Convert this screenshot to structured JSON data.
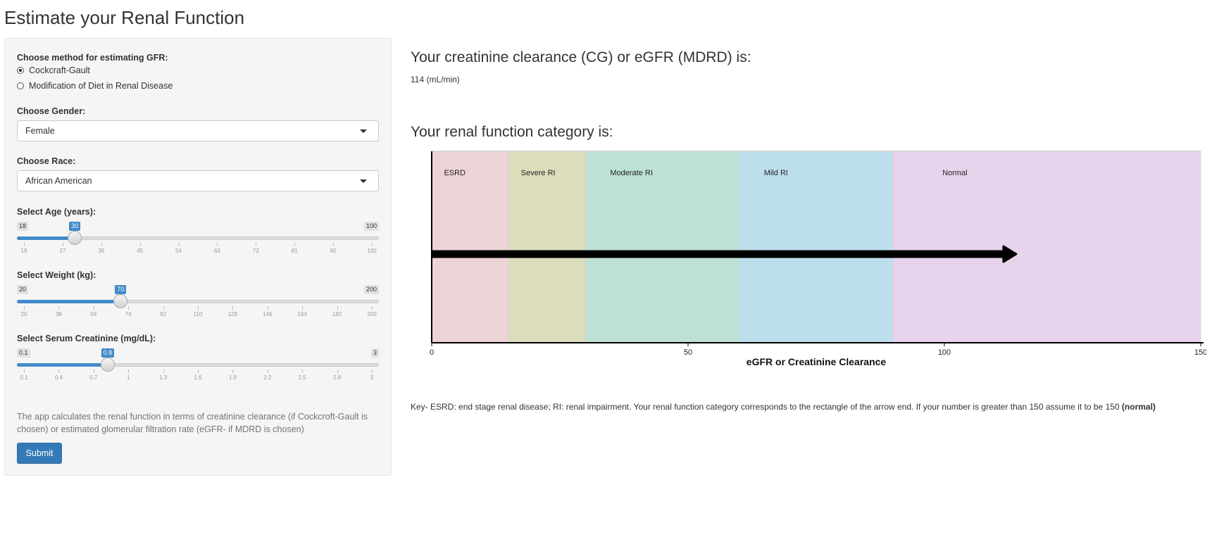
{
  "app": {
    "title": "Estimate your Renal Function"
  },
  "sidebar": {
    "method_label": "Choose method for estimating GFR:",
    "methods": [
      {
        "label": "Cockcraft-Gault",
        "selected": true
      },
      {
        "label": "Modification of Diet in Renal Disease",
        "selected": false
      }
    ],
    "gender_label": "Choose Gender:",
    "gender_value": "Female",
    "race_label": "Choose Race:",
    "race_value": "African American",
    "sliders": [
      {
        "label": "Select Age (years):",
        "min": 18,
        "max": 100,
        "value": 30,
        "min_label": "18",
        "max_label": "100",
        "value_label": "30",
        "ticks": [
          "18",
          "27",
          "36",
          "45",
          "54",
          "63",
          "72",
          "81",
          "90",
          "100"
        ]
      },
      {
        "label": "Select Weight (kg):",
        "min": 20,
        "max": 200,
        "value": 70,
        "min_label": "20",
        "max_label": "200",
        "value_label": "70",
        "ticks": [
          "20",
          "38",
          "56",
          "74",
          "92",
          "110",
          "128",
          "146",
          "164",
          "182",
          "200"
        ]
      },
      {
        "label": "Select Serum Creatinine (mg/dL):",
        "min": 0.1,
        "max": 3,
        "value": 0.8,
        "min_label": "0.1",
        "max_label": "3",
        "value_label": "0.8",
        "ticks": [
          "0.1",
          "0.4",
          "0.7",
          "1",
          "1.3",
          "1.6",
          "1.9",
          "2.2",
          "2.5",
          "2.8",
          "3"
        ]
      }
    ],
    "help_text": "The app calculates the renal function in terms of creatinine clearance (if Cockcroft-Gault is chosen) or estimated glomerular filtration rate (eGFR- if MDRD is chosen)",
    "submit_label": "Submit"
  },
  "main": {
    "result_heading": "Your creatinine clearance (CG) or eGFR (MDRD) is:",
    "result_value": "114 (mL/min)",
    "category_heading": "Your renal function category is:",
    "key_text": "Key- ESRD: end stage renal disease; RI: renal impairment. Your renal function category corresponds to the rectangle of the arrow end. If your number is greater than 150 assume it to be 150 ",
    "key_bold": "(normal)"
  },
  "chart_data": {
    "type": "bar",
    "xlabel": "eGFR or Creatinine Clearance",
    "xlim": [
      0,
      150
    ],
    "x_ticks": [
      0,
      50,
      100,
      150
    ],
    "categories": [
      {
        "name": "ESRD",
        "from": 0,
        "to": 15,
        "color": "#ecd3d5"
      },
      {
        "name": "Severe RI",
        "from": 15,
        "to": 30,
        "color": "#dcdebb"
      },
      {
        "name": "Moderate RI",
        "from": 30,
        "to": 60,
        "color": "#bde2d5"
      },
      {
        "name": "Mild RI",
        "from": 60,
        "to": 90,
        "color": "#bddeec"
      },
      {
        "name": "Normal",
        "from": 90,
        "to": 150,
        "color": "#e8d3ec"
      }
    ],
    "arrow_value": 114,
    "grid": false
  }
}
